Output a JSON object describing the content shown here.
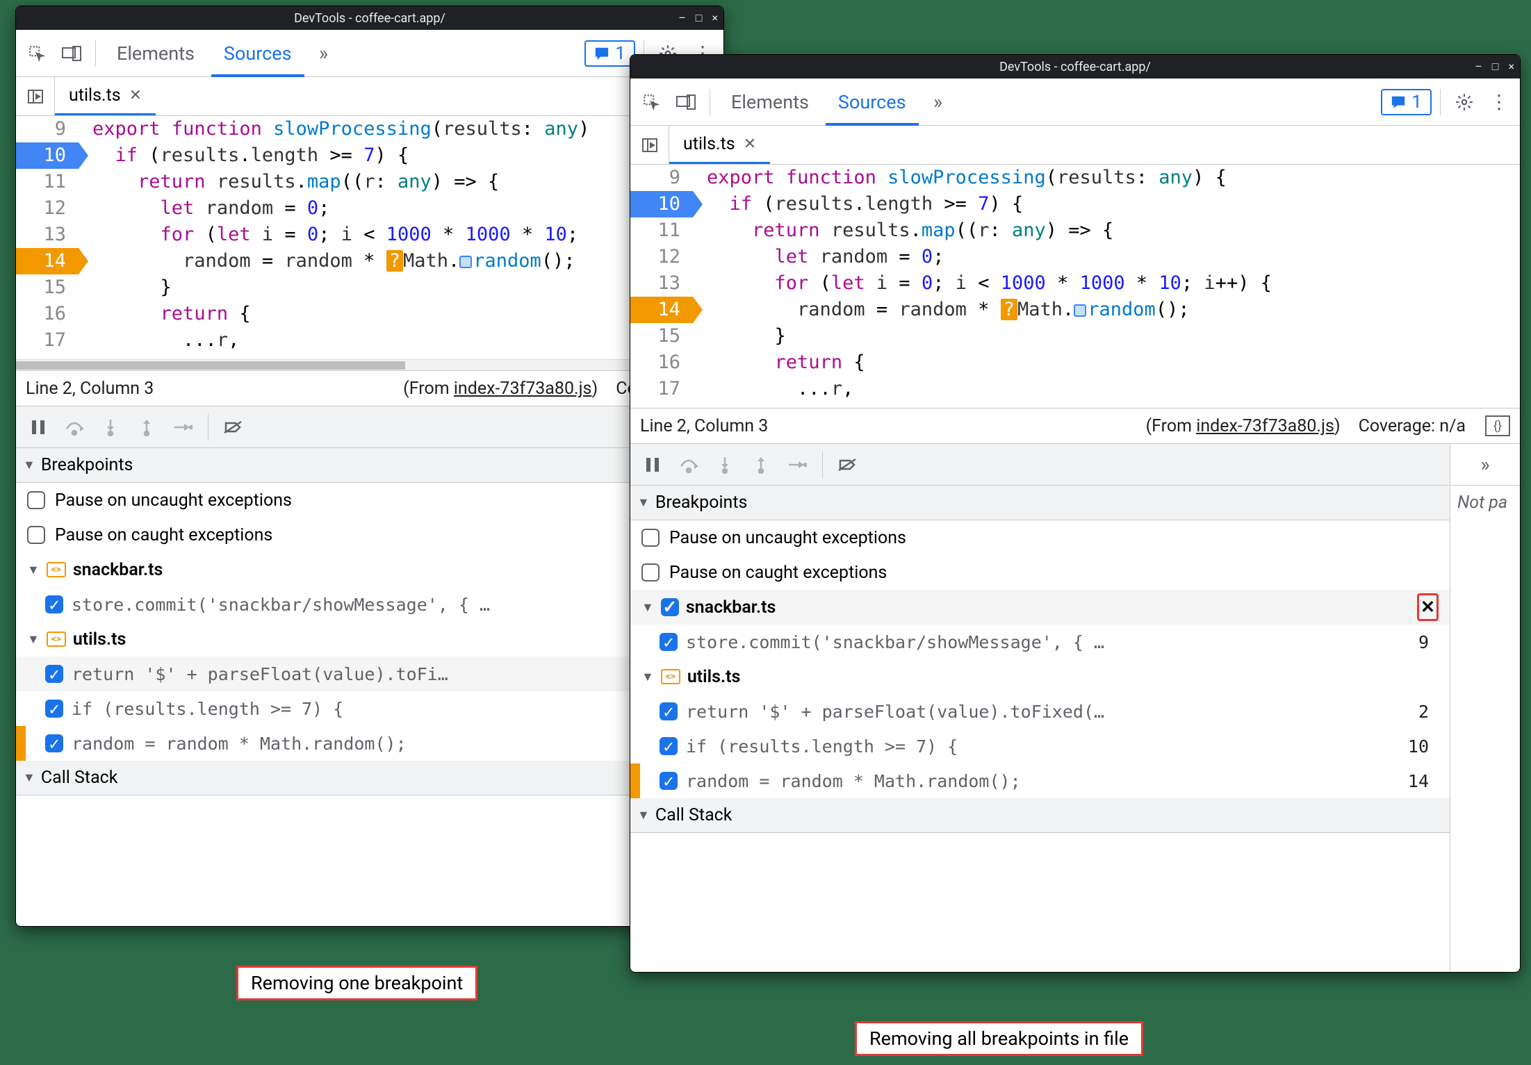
{
  "titlebar": "DevTools - coffee-cart.app/",
  "topbar": {
    "elements": "Elements",
    "sources": "Sources",
    "issue_count": "1"
  },
  "file": {
    "name": "utils.ts"
  },
  "code": {
    "lines": [
      {
        "n": 9,
        "html": "<span class='kw'>export</span> <span class='kw'>function</span> <span class='fn'>slowProcessing</span>(<span class='var'>results</span>: <span class='type'>any</span>)"
      },
      {
        "n": 10,
        "bp": "blue",
        "html": "  <span class='kw'>if</span> (<span class='var'>results</span>.<span class='var'>length</span> &gt;= <span class='num'>7</span>) {"
      },
      {
        "n": 11,
        "html": "    <span class='kw'>return</span> <span class='var'>results</span>.<span class='fn'>map</span>((<span class='var'>r</span>: <span class='type'>any</span>) =&gt; {"
      },
      {
        "n": 12,
        "html": "      <span class='kw'>let</span> <span class='var'>random</span> = <span class='num'>0</span>;"
      },
      {
        "n": 13,
        "html": "      <span class='kw'>for</span> (<span class='kw'>let</span> <span class='var'>i</span> = <span class='num'>0</span>; <span class='var'>i</span> &lt; <span class='num'>1000</span> * <span class='num'>1000</span> * <span class='num'>10</span>;"
      },
      {
        "n": 14,
        "bp": "orange",
        "q": true,
        "html": "        <span class='var'>random</span> = <span class='var'>random</span> * <span class='inline-bp'>?</span><span class='var'>Math</span>.<span class='inline-disc'></span><span class='fn'>random</span>();"
      },
      {
        "n": 15,
        "html": "      }"
      },
      {
        "n": 16,
        "html": "      <span class='kw'>return</span> {"
      },
      {
        "n": 17,
        "html": "        ...<span class='var'>r</span>,"
      }
    ]
  },
  "code2_extra_line13": "      <span class='kw'>for</span> (<span class='kw'>let</span> <span class='var'>i</span> = <span class='num'>0</span>; <span class='var'>i</span> &lt; <span class='num'>1000</span> * <span class='num'>1000</span> * <span class='num'>10</span>; <span class='var'>i</span>++) {",
  "code2_extra_line9_tail": " {",
  "status": {
    "pos": "Line 2, Column 3",
    "from_label": "(From ",
    "from_src": "index-73f73a80.js",
    "from_close": ")",
    "coverage_cut": "Coverage: n/",
    "coverage": "Coverage: n/a"
  },
  "sections": {
    "breakpoints": "Breakpoints",
    "callstack": "Call Stack",
    "pause_uncaught": "Pause on uncaught exceptions",
    "pause_caught": "Pause on caught exceptions"
  },
  "bp_files": {
    "snackbar": "snackbar.ts",
    "utils": "utils.ts"
  },
  "bp_items": {
    "snackbar1": {
      "code": "store.commit('snackbar/showMessage', { …",
      "line": "9"
    },
    "utils1": {
      "code": "return '$' + parseFloat(value).toFi…",
      "line": "2"
    },
    "utils1b": {
      "code": "return '$' + parseFloat(value).toFixed(…",
      "line": "2"
    },
    "utils2": {
      "code": "if (results.length >= 7) {",
      "line": "10"
    },
    "utils3": {
      "code": "random = random * Math.random();",
      "line": "14"
    }
  },
  "right_panel": {
    "not_paused": "Not pa"
  },
  "captions": {
    "left": "Removing one breakpoint",
    "right": "Removing all breakpoints in file"
  }
}
